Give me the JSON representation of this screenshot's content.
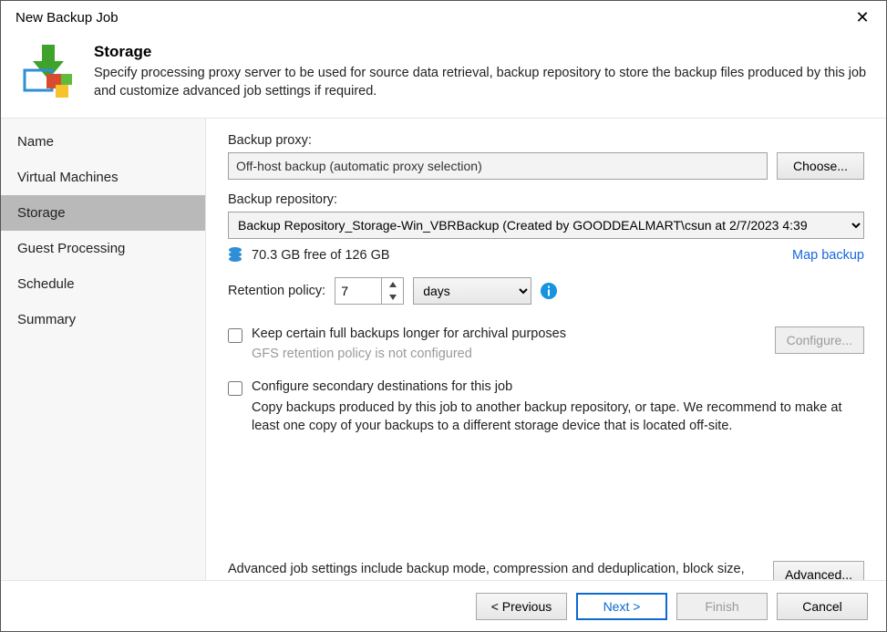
{
  "window": {
    "title": "New Backup Job"
  },
  "header": {
    "title": "Storage",
    "desc": "Specify processing proxy server to be used for source data retrieval, backup repository to store the backup files produced by this job and customize advanced job settings if required."
  },
  "sidebar": {
    "items": [
      {
        "label": "Name"
      },
      {
        "label": "Virtual Machines"
      },
      {
        "label": "Storage"
      },
      {
        "label": "Guest Processing"
      },
      {
        "label": "Schedule"
      },
      {
        "label": "Summary"
      }
    ],
    "selected_index": 2
  },
  "content": {
    "proxy_label": "Backup proxy:",
    "proxy_value": "Off-host backup (automatic proxy selection)",
    "choose_label": "Choose...",
    "repo_label": "Backup repository:",
    "repo_value": "Backup Repository_Storage-Win_VBRBackup (Created by GOODDEALMART\\csun at 2/7/2023 4:39",
    "free_text": "70.3 GB free of 126 GB",
    "map_backup": "Map backup",
    "retention_label": "Retention policy:",
    "retention_value": "7",
    "retention_unit": "days",
    "gfs_checkbox": "Keep certain full backups longer for archival purposes",
    "gfs_note": "GFS retention policy is not configured",
    "configure_label": "Configure...",
    "secondary_checkbox": "Configure secondary destinations for this job",
    "secondary_desc": "Copy backups produced by this job to another backup repository, or tape. We recommend to make at least one copy of your backups to a different storage device that is located off-site.",
    "advanced_desc": "Advanced job settings include backup mode, compression and deduplication, block size, notification settings, automated post-job activity and other settings.",
    "advanced_label": "Advanced..."
  },
  "footer": {
    "previous": "< Previous",
    "next": "Next >",
    "finish": "Finish",
    "cancel": "Cancel"
  }
}
